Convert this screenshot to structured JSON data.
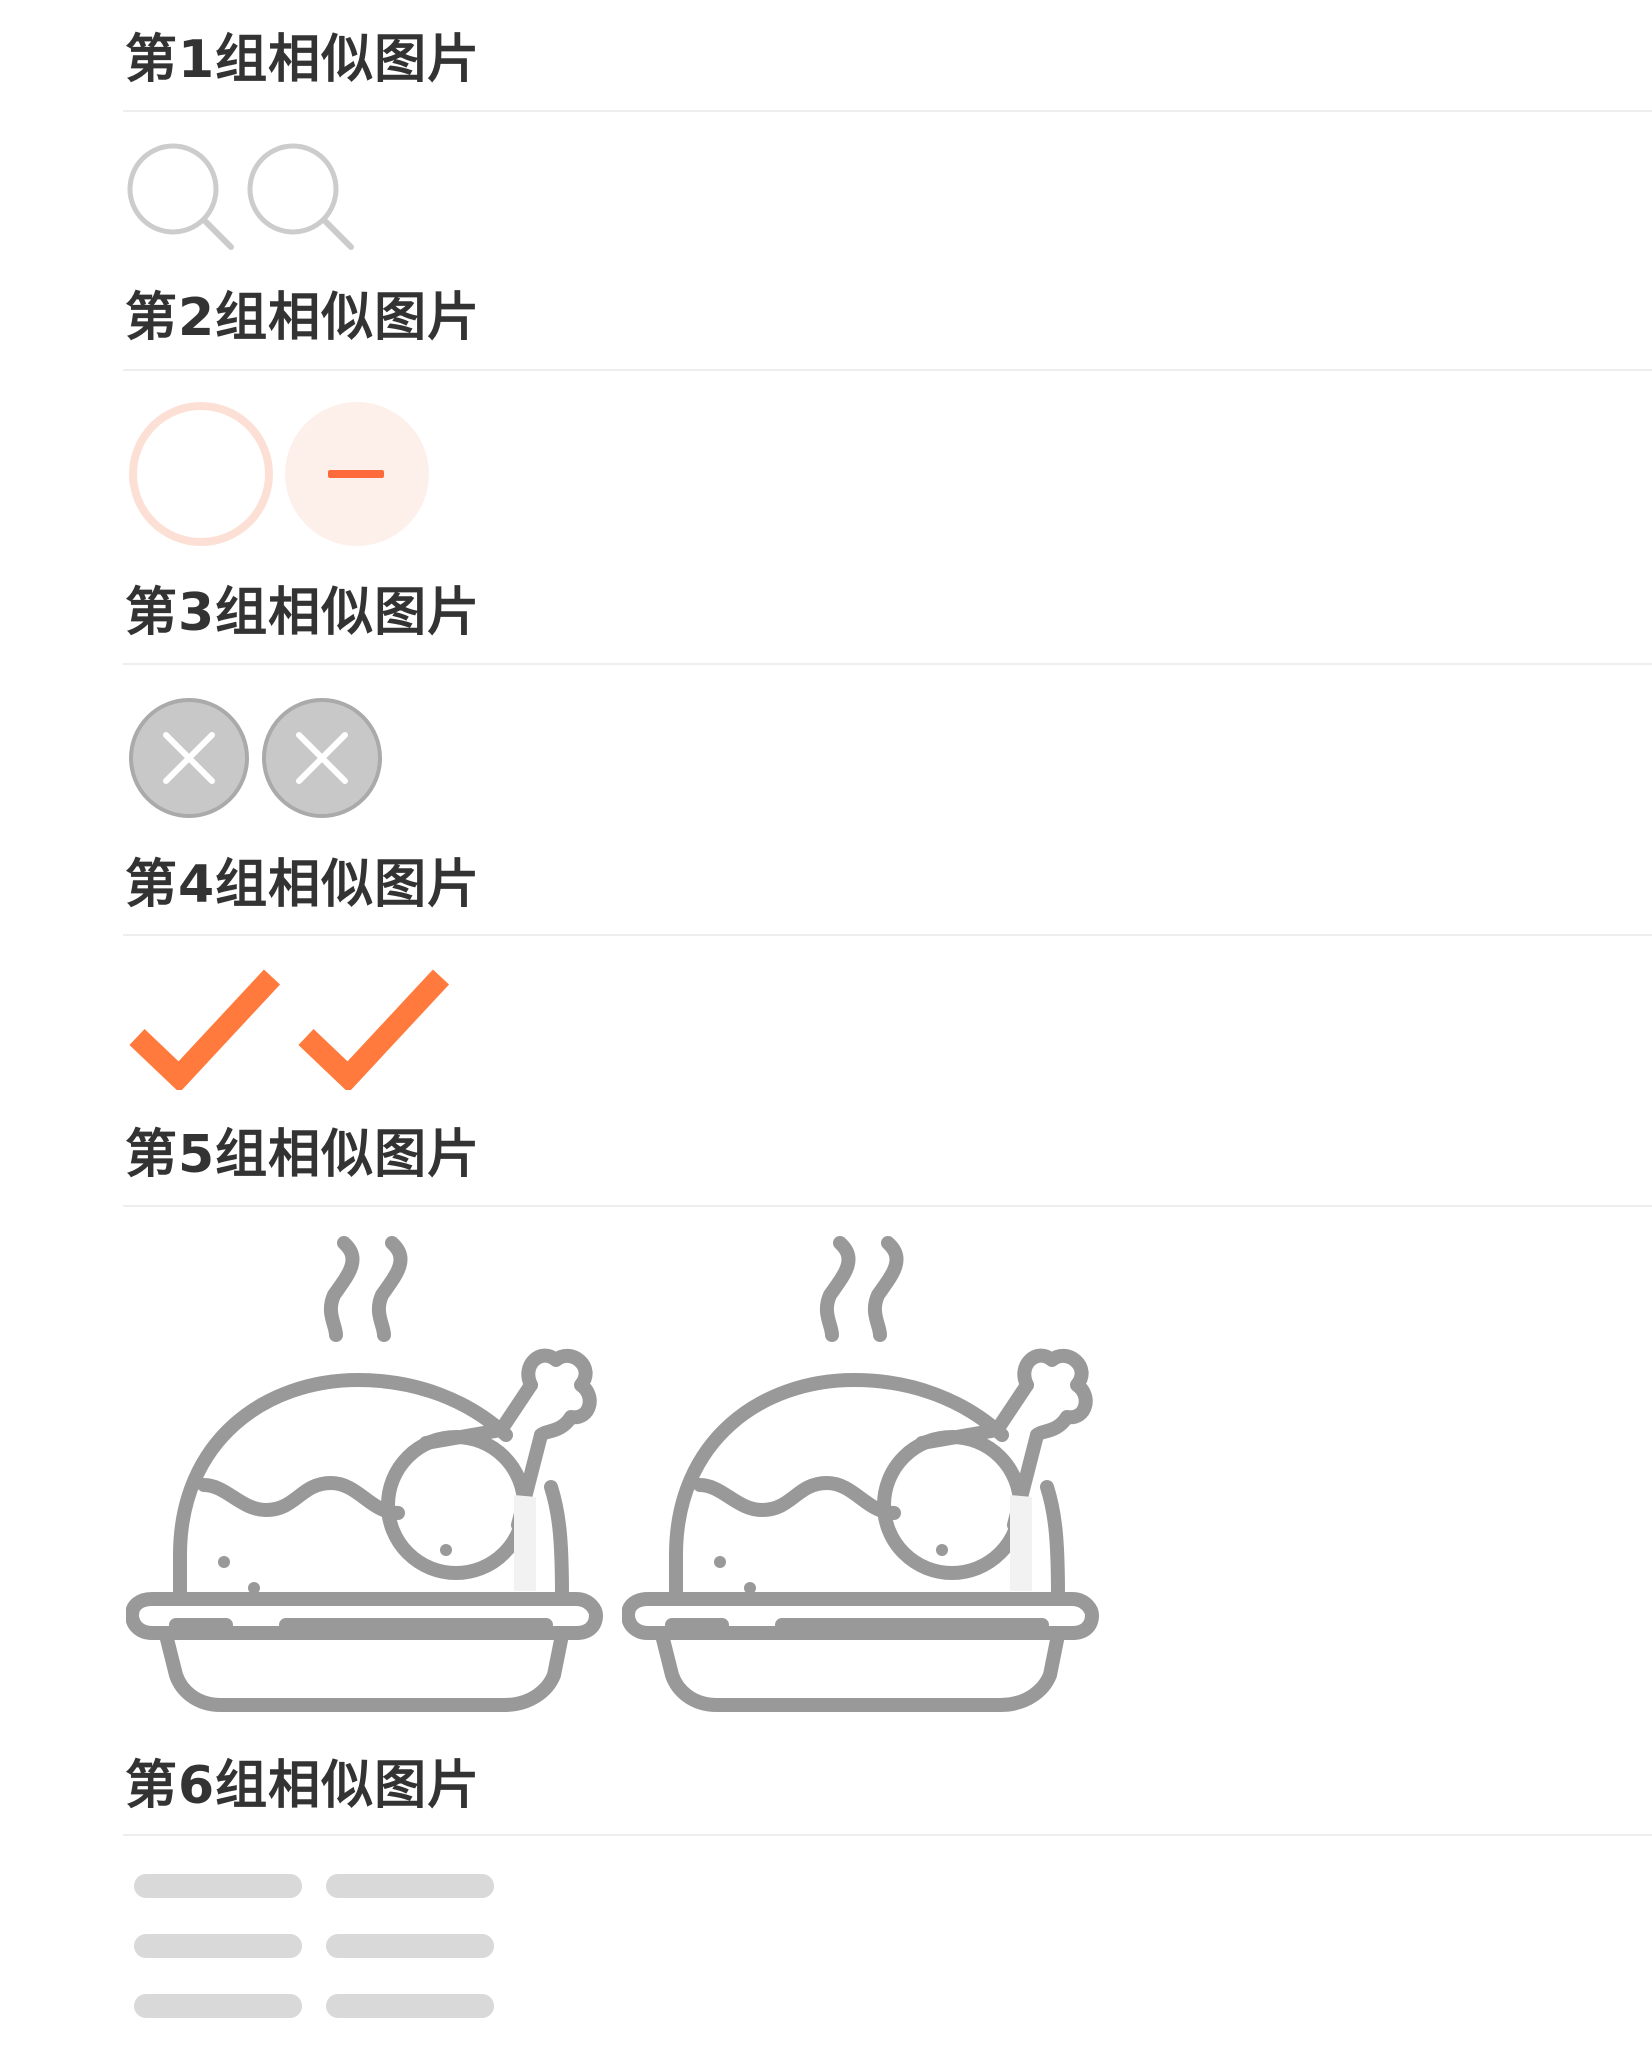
{
  "groups": [
    {
      "title": "第1组相似图片",
      "icons": [
        "search-icon",
        "search-icon"
      ],
      "color": "#cccccc"
    },
    {
      "title": "第2组相似图片",
      "icons": [
        "empty-circle-icon",
        "minus-circle-icon"
      ],
      "color": "#ff6a3d"
    },
    {
      "title": "第3组相似图片",
      "icons": [
        "close-circle-icon",
        "close-circle-icon"
      ],
      "color": "#bbbbbb"
    },
    {
      "title": "第4组相似图片",
      "icons": [
        "checkmark-icon",
        "checkmark-icon"
      ],
      "color": "#ff7a3c"
    },
    {
      "title": "第5组相似图片",
      "icons": [
        "roast-chicken-icon",
        "roast-chicken-icon"
      ],
      "color": "#999999"
    },
    {
      "title": "第6组相似图片",
      "icons": [
        "placeholder-lines-icon"
      ],
      "color": "#dddddd"
    }
  ]
}
